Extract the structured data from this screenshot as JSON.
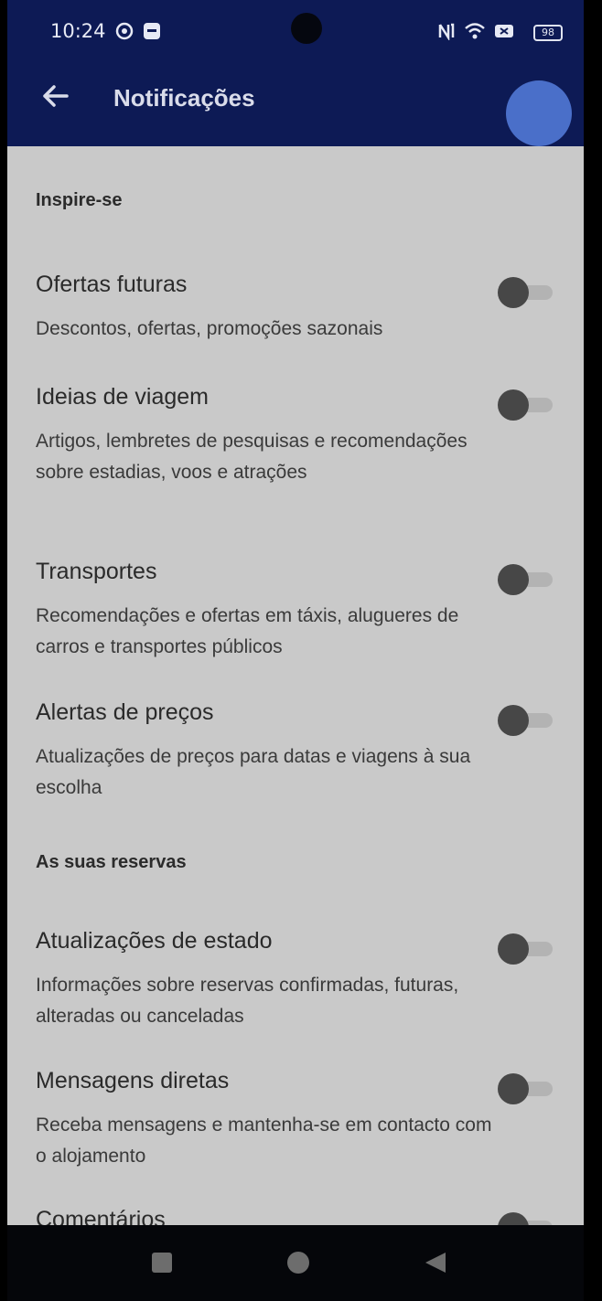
{
  "status_bar": {
    "time": "10:24",
    "battery": "98"
  },
  "app_bar": {
    "title": "Notificações"
  },
  "sections": [
    {
      "title": "Inspire-se"
    },
    {
      "title": "As suas reservas"
    }
  ],
  "settings": [
    {
      "title": "Ofertas futuras",
      "description": "Descontos, ofertas, promoções sazonais",
      "enabled": false
    },
    {
      "title": "Ideias de viagem",
      "description": "Artigos, lembretes de pesquisas e recomendações sobre estadias, voos e atrações",
      "enabled": false
    },
    {
      "title": "Transportes",
      "description": "Recomendações e ofertas em táxis, alugueres de carros e transportes públicos",
      "enabled": false
    },
    {
      "title": "Alertas de preços",
      "description": "Atualizações de preços para datas e viagens à sua escolha",
      "enabled": false
    },
    {
      "title": "Atualizações de estado",
      "description": "Informações sobre reservas confirmadas, futuras, alteradas ou canceladas",
      "enabled": false
    },
    {
      "title": "Mensagens diretas",
      "description": "Receba mensagens e mantenha-se em contacto com o alojamento",
      "enabled": false
    },
    {
      "title": "Comentários",
      "description": "",
      "enabled": false
    }
  ],
  "icons": {
    "back": "back-arrow-icon",
    "recents": "square-icon",
    "home": "circle-icon",
    "nav_back": "triangle-icon"
  },
  "colors": {
    "app_bar": "#0d1a55",
    "content_bg": "#c9c9c9",
    "avatar": "#4a6fc9"
  }
}
